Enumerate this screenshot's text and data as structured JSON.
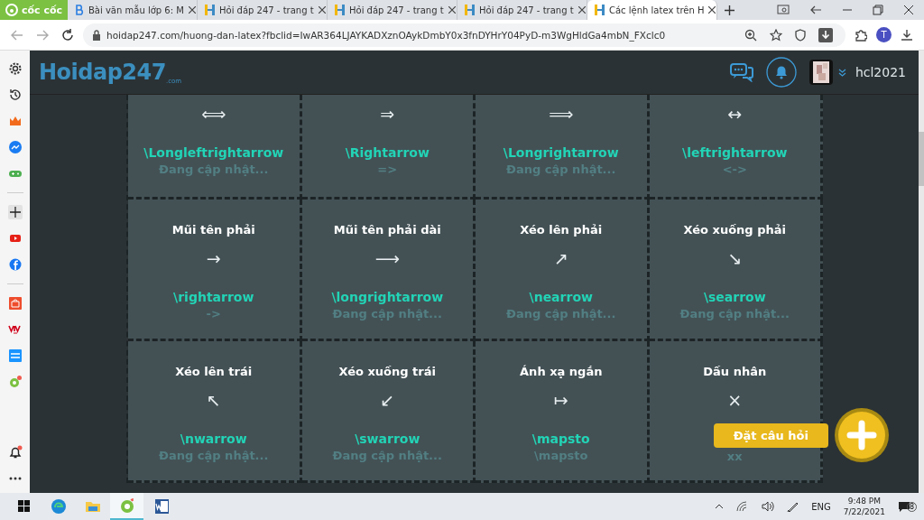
{
  "browser": {
    "brand": "cốc cốc",
    "tabs": [
      {
        "title": "Bài văn mẫu lớp 6: M",
        "kind": "blog",
        "selected": false
      },
      {
        "title": "Hỏi đáp 247 - trang t",
        "kind": "hoidap",
        "selected": false
      },
      {
        "title": "Hỏi đáp 247 - trang t",
        "kind": "hoidap",
        "selected": false
      },
      {
        "title": "Hỏi đáp 247 - trang t",
        "kind": "hoidap",
        "selected": false
      },
      {
        "title": "Các lệnh latex trên H",
        "kind": "hoidap",
        "selected": true
      }
    ],
    "url": "hoidap247.com/huong-dan-latex?fbclid=IwAR364LJAYKADXznOAykDmbY0x3fnDYHrY04PyD-m3WgHldGa4mbN_FXclc0",
    "profile_initial": "T"
  },
  "header": {
    "logo": "Hoidap247",
    "logo_suffix": ".com",
    "username": "hcl2021"
  },
  "symbols": [
    {
      "symbol": "⟺",
      "command": "\\Longleftrightarrow",
      "note": "Đang cập nhật..."
    },
    {
      "symbol": "⇒",
      "command": "\\Rightarrow",
      "note": "=>"
    },
    {
      "symbol": "⟹",
      "command": "\\Longrightarrow",
      "note": "Đang cập nhật..."
    },
    {
      "symbol": "↔",
      "command": "\\leftrightarrow",
      "note": "<->"
    },
    {
      "title": "Mũi tên phải",
      "symbol": "→",
      "command": "\\rightarrow",
      "note": "->"
    },
    {
      "title": "Mũi tên phải dài",
      "symbol": "⟶",
      "command": "\\longrightarrow",
      "note": "Đang cập nhật..."
    },
    {
      "title": "Xéo lên phải",
      "symbol": "↗",
      "command": "\\nearrow",
      "note": "Đang cập nhật..."
    },
    {
      "title": "Xéo xuống phải",
      "symbol": "↘",
      "command": "\\searrow",
      "note": "Đang cập nhật..."
    },
    {
      "title": "Xéo lên trái",
      "symbol": "↖",
      "command": "\\nwarrow",
      "note": "Đang cập nhật..."
    },
    {
      "title": "Xéo xuống trái",
      "symbol": "↙",
      "command": "\\swarrow",
      "note": "Đang cập nhật..."
    },
    {
      "title": "Ánh xạ ngắn",
      "symbol": "↦",
      "command": "\\mapsto",
      "note": "\\mapsto"
    },
    {
      "title": "Dấu nhân",
      "symbol": "×",
      "note": "xx"
    }
  ],
  "ask_button": {
    "label": "Đặt câu hỏi"
  },
  "taskbar": {
    "apps": [
      {
        "kind": "start",
        "selected": false
      },
      {
        "kind": "edge",
        "selected": false
      },
      {
        "kind": "folder",
        "selected": false
      },
      {
        "kind": "coccoc",
        "selected": true
      },
      {
        "kind": "word",
        "selected": false
      }
    ],
    "language": "ENG",
    "time": "9:48 PM",
    "date": "7/22/2021",
    "notifications": "8"
  }
}
